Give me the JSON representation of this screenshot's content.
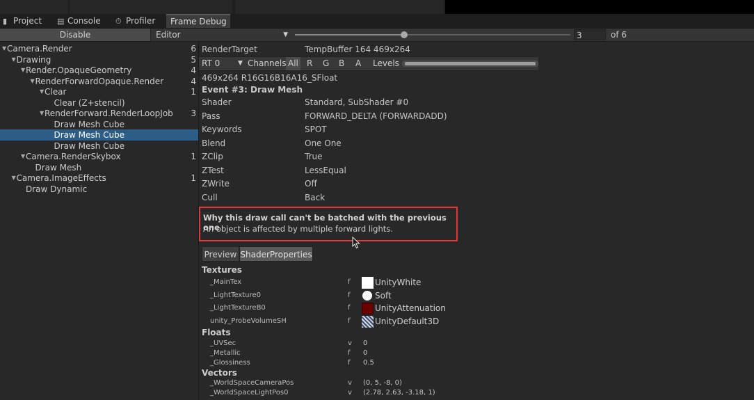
{
  "tabs": [
    {
      "label": "Project",
      "icon": "folder-icon"
    },
    {
      "label": "Console",
      "icon": "console-icon"
    },
    {
      "label": "Profiler",
      "icon": "profiler-icon"
    },
    {
      "label": "Frame Debug",
      "icon": ""
    }
  ],
  "toolbar": {
    "disable_label": "Disable",
    "editor_label": "Editor",
    "frame_value": "3",
    "frame_of": "of 6",
    "frame_index": 3,
    "frame_total": 6
  },
  "tree": [
    {
      "label": "Camera.Render",
      "count": "6",
      "expanded": true
    },
    {
      "label": "Drawing",
      "count": "5",
      "expanded": true
    },
    {
      "label": "Render.OpaqueGeometry",
      "count": "4",
      "expanded": true
    },
    {
      "label": "RenderForwardOpaque.Render",
      "count": "4",
      "expanded": true
    },
    {
      "label": "Clear",
      "count": "1",
      "expanded": true
    },
    {
      "label": "Clear (Z+stencil)",
      "count": ""
    },
    {
      "label": "RenderForward.RenderLoopJob",
      "count": "3",
      "expanded": true
    },
    {
      "label": "Draw Mesh Cube",
      "count": ""
    },
    {
      "label": "Draw Mesh Cube",
      "count": "",
      "selected": true
    },
    {
      "label": "Draw Mesh Cube",
      "count": ""
    },
    {
      "label": "Camera.RenderSkybox",
      "count": "1",
      "expanded": true
    },
    {
      "label": "Draw Mesh",
      "count": ""
    },
    {
      "label": "Camera.ImageEffects",
      "count": "1",
      "expanded": true
    },
    {
      "label": "Draw Dynamic",
      "count": ""
    }
  ],
  "render_target": {
    "label": "RenderTarget",
    "value": "TempBuffer 164 469x264"
  },
  "rt_row": {
    "rt": "RT 0",
    "channels_label": "Channels",
    "channels": [
      "All",
      "R",
      "G",
      "B",
      "A"
    ],
    "levels_label": "Levels"
  },
  "format": "469x264 R16G16B16A16_SFloat",
  "event_title": "Event #3: Draw Mesh",
  "props": [
    {
      "label": "Shader",
      "value": "Standard, SubShader #0"
    },
    {
      "label": "Pass",
      "value": "FORWARD_DELTA (FORWARDADD)"
    },
    {
      "label": "Keywords",
      "value": "SPOT"
    },
    {
      "label": "Blend",
      "value": "One One"
    },
    {
      "label": "ZClip",
      "value": "True"
    },
    {
      "label": "ZTest",
      "value": "LessEqual"
    },
    {
      "label": "ZWrite",
      "value": "Off"
    },
    {
      "label": "Cull",
      "value": "Back"
    }
  ],
  "batch": {
    "title": "Why this draw call can't be batched with the previous one",
    "desc": "An object is affected by multiple forward lights.",
    "border_color": "#e0393b"
  },
  "subtabs": [
    "Preview",
    "ShaderProperties"
  ],
  "textures_label": "Textures",
  "textures": [
    {
      "name": "_MainTex",
      "type": "f",
      "value": "UnityWhite"
    },
    {
      "name": "_LightTexture0",
      "type": "f",
      "value": "Soft"
    },
    {
      "name": "_LightTextureB0",
      "type": "f",
      "value": "UnityAttenuation"
    },
    {
      "name": "unity_ProbeVolumeSH",
      "type": "f",
      "value": "UnityDefault3D"
    }
  ],
  "floats_label": "Floats",
  "floats": [
    {
      "name": "_UVSec",
      "type": "v",
      "value": "0"
    },
    {
      "name": "_Metallic",
      "type": "f",
      "value": "0"
    },
    {
      "name": "_Glossiness",
      "type": "f",
      "value": "0.5"
    }
  ],
  "vectors_label": "Vectors",
  "vectors": [
    {
      "name": "_WorldSpaceCameraPos",
      "type": "v",
      "value": "(0, 5, -8, 0)"
    },
    {
      "name": "_WorldSpaceLightPos0",
      "type": "v",
      "value": "(2.78, 2.63, -3.18, 1)"
    }
  ]
}
